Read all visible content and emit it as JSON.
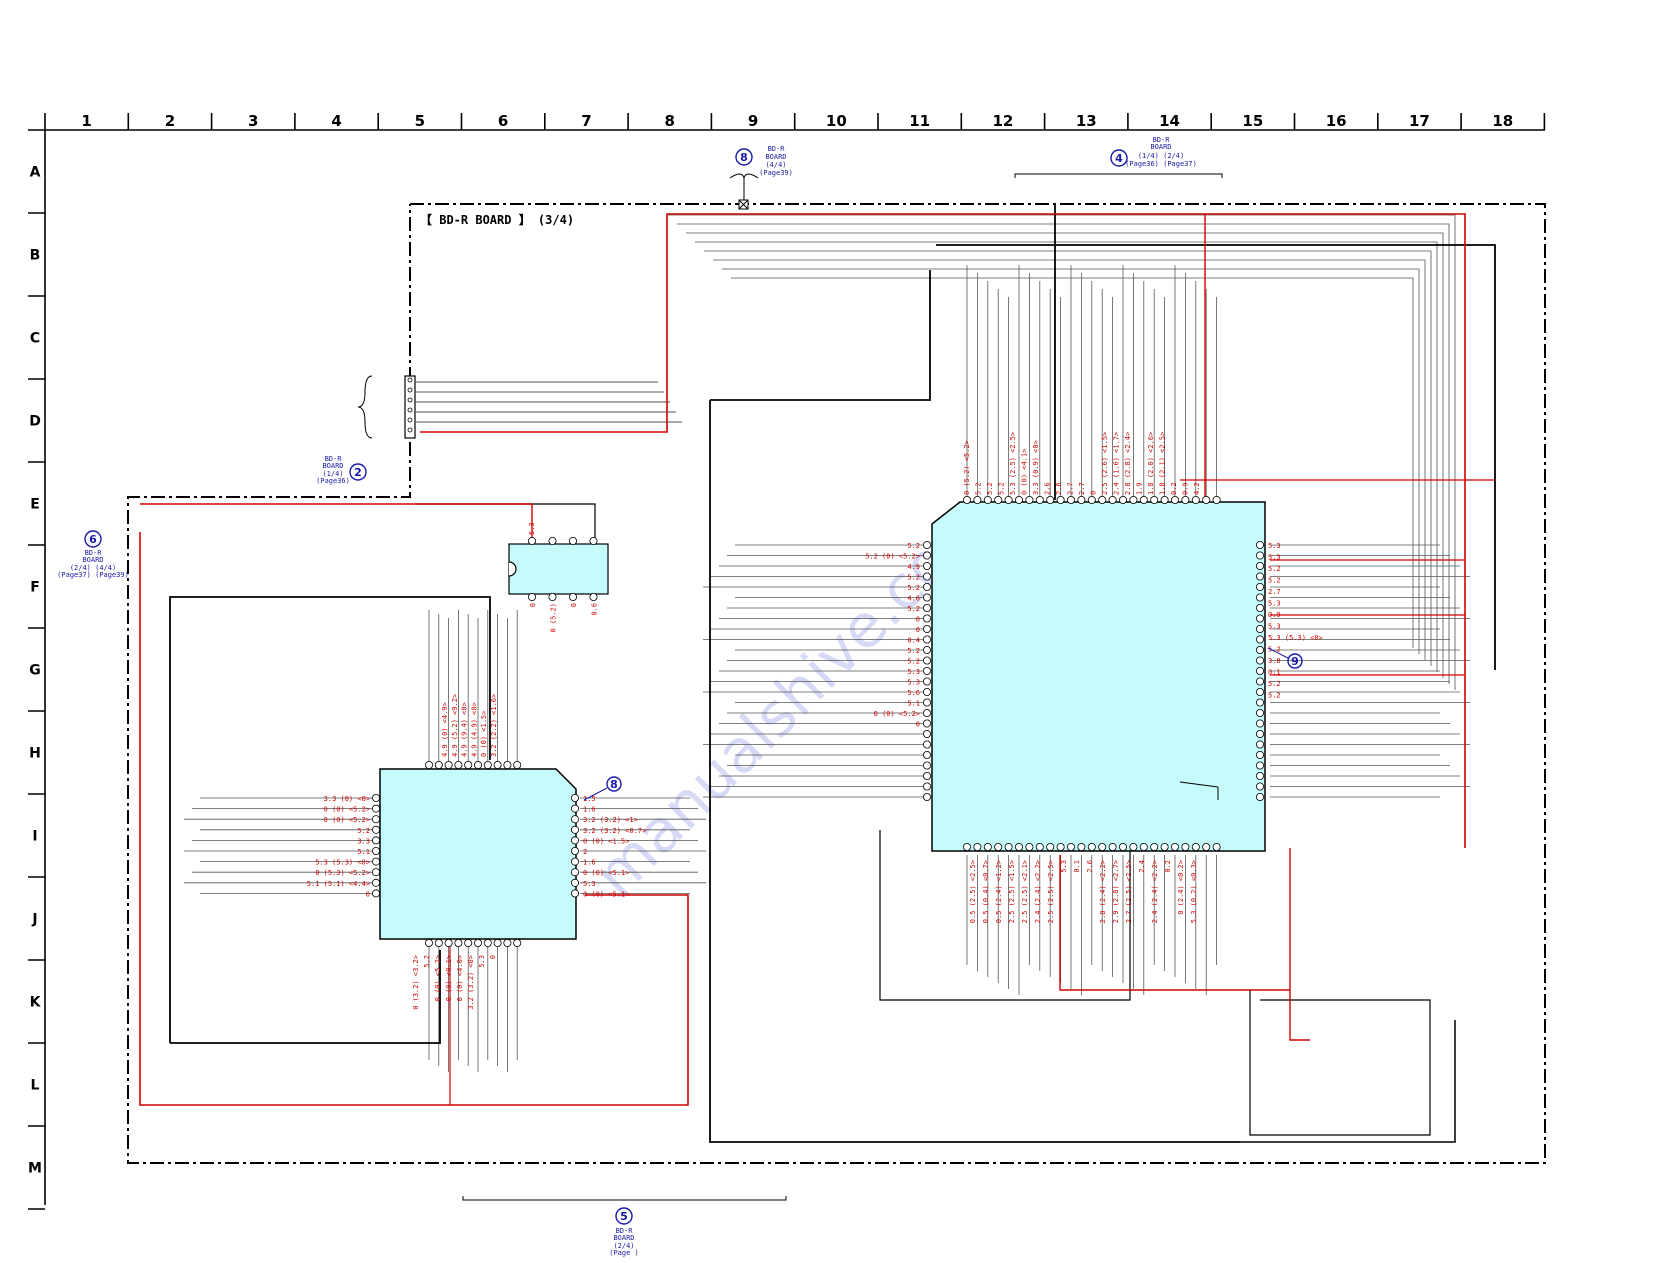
{
  "sheet": {
    "board_title": "【 BD-R BOARD 】 (3/4)",
    "columns": [
      "1",
      "2",
      "3",
      "4",
      "5",
      "6",
      "7",
      "8",
      "9",
      "10",
      "11",
      "12",
      "13",
      "14",
      "15",
      "16",
      "17",
      "18"
    ],
    "rows": [
      "A",
      "B",
      "C",
      "D",
      "E",
      "F",
      "G",
      "H",
      "I",
      "J",
      "K",
      "L",
      "M"
    ],
    "watermark": "manualshive.com"
  },
  "refs": {
    "ref_8_top": {
      "num": "8",
      "lines": [
        "BD-R",
        "BOARD",
        "(4/4)",
        "(Page39)"
      ]
    },
    "ref_4_top": {
      "num": "4",
      "lines": [
        "BD-R",
        "BOARD",
        "(1/4)   (2/4)",
        "(Page36) (Page37)"
      ]
    },
    "ref_2_left": {
      "num": "2",
      "lines": [
        "BD-R",
        "BOARD",
        "(1/4)",
        "(Page36)"
      ]
    },
    "ref_6_left": {
      "num": "6",
      "lines": [
        "BD-R",
        "BOARD",
        "(2/4)   (4/4)",
        "(Page37) (Page39)"
      ]
    },
    "ref_5_bottom": {
      "num": "5",
      "lines": [
        "BD-R",
        "BOARD",
        "(2/4)",
        "(Page  )"
      ]
    },
    "marker_9": "9",
    "marker_8": "8"
  },
  "colors": {
    "wire": "#000000",
    "supply_wire": "#d40000",
    "chip_fill": "#c6fbfc",
    "label": "#cc0000",
    "marker": "#1a1aa8"
  },
  "labels": {
    "ic_top_pins": [
      "0 (5.2) <5.2>",
      "5.2",
      "5.2",
      "5.2",
      "5.3 (2.5) <2.5>",
      "0 (0) <4.1>",
      "3.3 (0.9) <0>",
      "2.6",
      "2.6",
      "2.7",
      "2.7",
      "0",
      "2.5 (2.6) <1.5>",
      "2.4 (1.6) <1.7>",
      "2.8 (2.8) <2.4>",
      "1.9",
      "1.8 (2.0) <2.6>",
      "1.8 (2.1) <2.5>",
      "0.2",
      "0.9",
      "4.2"
    ],
    "ic_left_pins": [
      "5.2",
      "5.2 (0) <5.2>",
      "4.9",
      "5.2",
      "5.2",
      "4.6",
      "5.2",
      "0",
      "0",
      "0.4",
      "5.2",
      "5.2",
      "5.3",
      "5.3",
      "5.6",
      "5.1",
      "0 (0) <5.2>",
      "0"
    ],
    "ic_right_pins": [
      "5.3",
      "5.3",
      "5.2",
      "5.2",
      "2.7",
      "5.3",
      "0.9",
      "5.3",
      "5.3 (5.3) <0>",
      "5.2",
      "3.8",
      "0.1",
      "5.2",
      "5.2"
    ],
    "ic_bottom_pins": [
      "0.5 (2.5) <2.5>",
      "0.5 (0.4) <0.7>",
      "0.5 (2.4) <1.2>",
      "2.5 (2.5) <1.5>",
      "2.5 (2.5) <2.1>",
      "2.4 (2.4) <2.2>",
      "2.5 (2.5) <2.5>",
      "5.3",
      "0.1",
      "2.6",
      "2.8 (2.4) <2.2>",
      "2.9 (2.8) <2.7>",
      "2.7 (2.5) <2.5>",
      "2.4",
      "2.4 (2.4) <2.2>",
      "0.2",
      "0 (2.4) <0.2>",
      "5.3 (0.2) <0.3>"
    ],
    "ic2_top_pins": [
      "4.9 (0) <4.9>",
      "4.9 (5.2) <9.2>",
      "4.9 (9.4) <0>",
      "4.9 (4.9) <0>",
      "0 (0) <1.5>",
      "3.2 (2.2) <1.6>"
    ],
    "ic2_left_pins": [
      "3.3 (0) <0>",
      "0 (0) <5.2>",
      "0 (0) <5.2>",
      "5.2",
      "3.3",
      "5.1",
      "5.3 (5.3) <0>",
      "0 (5.3) <5.2>",
      "5.1 (5.1) <4.4>",
      "0"
    ],
    "ic2_right_pins": [
      "1.5",
      "1.6",
      "3.2 (3.2) <1>",
      "3.2 (3.2) <0.7>",
      "0 (0) <1.5>",
      "2",
      "1.6",
      "0 (0) <5.1>",
      "5.3",
      "0 (0) <5.1>"
    ],
    "ic2_bottom_pins": [
      "0 (3.2) <3.2>",
      "5.2",
      "0 (0) <5.2>",
      "0 (0) <0.1>",
      "0 (0) <4.0>",
      "3.2 (3.2) <0>",
      "5.3",
      "0"
    ],
    "ic3_top_pins": [
      "5.3"
    ],
    "ic3_bottom_pins": [
      "0",
      "0 (5.2)",
      "0",
      "0.6"
    ]
  }
}
